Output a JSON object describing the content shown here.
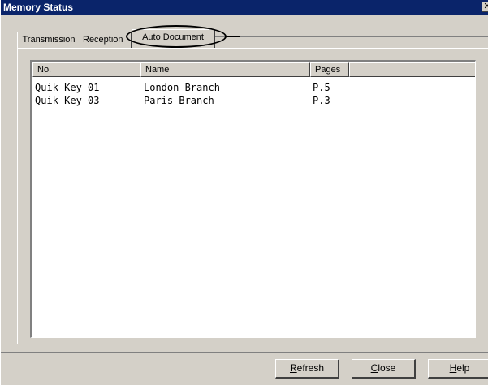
{
  "window": {
    "title": "Memory Status",
    "close_glyph": "✕"
  },
  "tabs": [
    {
      "label": "Transmission",
      "selected": false
    },
    {
      "label": "Reception",
      "selected": false
    },
    {
      "label": "Auto Document",
      "selected": true
    }
  ],
  "list": {
    "columns": [
      "No.",
      "Name",
      "Pages"
    ],
    "rows": [
      {
        "no": "Quik Key 01",
        "name": "London Branch",
        "pages": "P.5"
      },
      {
        "no": "Quik Key 03",
        "name": "Paris Branch",
        "pages": "P.3"
      }
    ]
  },
  "buttons": {
    "refresh": {
      "mnemonic": "R",
      "rest": "efresh"
    },
    "close": {
      "mnemonic": "C",
      "rest": "lose"
    },
    "help": {
      "mnemonic": "H",
      "rest": "elp"
    }
  },
  "colors": {
    "titlebar": "#0a246a",
    "face": "#d4d0c8",
    "annotation": "#000000"
  }
}
